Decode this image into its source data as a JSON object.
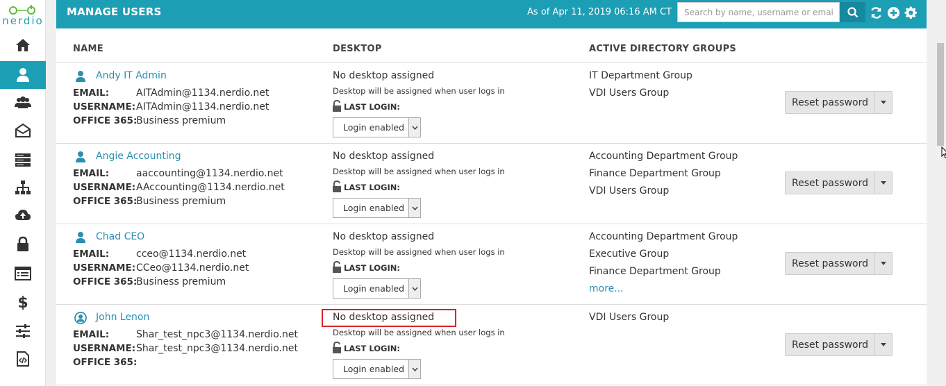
{
  "app": {
    "logo_text": "nerdio"
  },
  "sidebar": {
    "items": [
      {
        "name": "home",
        "icon": "home-icon"
      },
      {
        "name": "users",
        "icon": "user-icon",
        "active": true
      },
      {
        "name": "groups",
        "icon": "users-group-icon"
      },
      {
        "name": "email",
        "icon": "envelope-open-icon"
      },
      {
        "name": "servers",
        "icon": "server-icon"
      },
      {
        "name": "network",
        "icon": "sitemap-icon"
      },
      {
        "name": "cloud",
        "icon": "cloud-upload-icon"
      },
      {
        "name": "security",
        "icon": "lock-icon"
      },
      {
        "name": "list",
        "icon": "list-icon"
      },
      {
        "name": "billing",
        "icon": "dollar-icon"
      },
      {
        "name": "settings",
        "icon": "sliders-icon"
      },
      {
        "name": "scripts",
        "icon": "code-file-icon"
      }
    ]
  },
  "header": {
    "title": "MANAGE USERS",
    "timestamp": "As of Apr 11, 2019 06:16 AM CT",
    "search_placeholder": "Search by name, username or email...",
    "search_value": ""
  },
  "columns": {
    "name": "NAME",
    "desktop": "DESKTOP",
    "groups": "ACTIVE DIRECTORY GROUPS"
  },
  "labels": {
    "email": "EMAIL:",
    "username": "USERNAME:",
    "office": "OFFICE 365:",
    "last_login": "LAST LOGIN:",
    "reset": "Reset password",
    "more": "more..."
  },
  "users": [
    {
      "name": "Andy IT Admin",
      "email": "AITAdmin@1134.nerdio.net",
      "username": "AITAdmin@1134.nerdio.net",
      "office": "Business premium",
      "desktop_status": "No desktop assigned",
      "desktop_note": "Desktop will be assigned when user logs in",
      "login_state": "Login enabled",
      "groups": [
        "IT Department Group",
        "VDI Users Group"
      ]
    },
    {
      "name": "Angie Accounting",
      "email": "aaccounting@1134.nerdio.net",
      "username": "AAccounting@1134.nerdio.net",
      "office": "Business premium",
      "desktop_status": "No desktop assigned",
      "desktop_note": "Desktop will be assigned when user logs in",
      "login_state": "Login enabled",
      "groups": [
        "Accounting Department Group",
        "Finance Department Group",
        "VDI Users Group"
      ]
    },
    {
      "name": "Chad CEO",
      "email": "cceo@1134.nerdio.net",
      "username": "CCeo@1134.nerdio.net",
      "office": "Business premium",
      "desktop_status": "No desktop assigned",
      "desktop_note": "Desktop will be assigned when user logs in",
      "login_state": "Login enabled",
      "groups": [
        "Accounting Department Group",
        "Executive Group",
        "Finance Department Group"
      ],
      "has_more": true
    },
    {
      "name": "John Lenon",
      "email": "Shar_test_npc3@1134.nerdio.net",
      "username": "Shar_test_npc3@1134.nerdio.net",
      "office": "",
      "desktop_status": "No desktop assigned",
      "desktop_note": "Desktop will be assigned when user logs in",
      "login_state": "Login enabled",
      "groups": [
        "VDI Users Group"
      ],
      "highlighted": true
    }
  ],
  "colors": {
    "accent": "#1c9eb4",
    "link": "#2a8fb0",
    "highlight_border": "#d9252a"
  }
}
